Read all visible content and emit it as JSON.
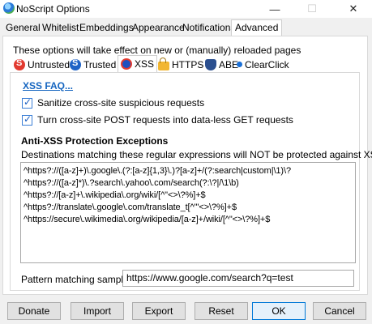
{
  "window": {
    "title": "NoScript Options",
    "minimize": "—",
    "maximize": "☐",
    "close": "✕"
  },
  "main_tabs": [
    {
      "label": "General"
    },
    {
      "label": "Whitelist"
    },
    {
      "label": "Embeddings"
    },
    {
      "label": "Appearance"
    },
    {
      "label": "Notifications"
    },
    {
      "label": "Advanced",
      "active": true
    }
  ],
  "notice": "These options will take effect on new or (manually) reloaded pages",
  "sub_tabs": [
    {
      "label": "Untrusted",
      "icon": "untrusted-icon"
    },
    {
      "label": "Trusted",
      "icon": "trusted-icon"
    },
    {
      "label": "XSS",
      "icon": "xss-icon",
      "active": true
    },
    {
      "label": "HTTPS",
      "icon": "lock-icon"
    },
    {
      "label": "ABE",
      "icon": "abe-icon"
    },
    {
      "label": "ClearClick",
      "icon": "clearclick-icon"
    }
  ],
  "xss": {
    "faq_link": "XSS FAQ...",
    "checkboxes": [
      {
        "label": "Sanitize cross-site suspicious requests",
        "checked": true
      },
      {
        "label": "Turn cross-site POST requests into data-less GET requests",
        "checked": true
      }
    ],
    "section_title": "Anti-XSS Protection Exceptions",
    "section_desc": "Destinations matching these regular expressions will NOT be protected against XSS.",
    "exceptions": [
      "^https?://([a-z]+)\\.google\\.(?:[a-z]{1,3}\\.)?[a-z]+/(?:search|custom|\\1)\\?",
      "^https?://([a-z]*)\\.?search\\.yahoo\\.com/search(?:\\?|/\\1\\b)",
      "^https?://[a-z]+\\.wikipedia\\.org/wiki/[^\"<>\\?%]+$",
      "^https?://translate\\.google\\.com/translate_t[^\"'<>\\?%]+$",
      "^https://secure\\.wikimedia\\.org/wikipedia/[a-z]+/wiki/[^\"<>\\?%]+$"
    ],
    "pattern_label": "Pattern matching sample:",
    "pattern_value": "https://www.google.com/search?q=test"
  },
  "buttons": {
    "donate": "Donate",
    "import": "Import",
    "export": "Export",
    "reset": "Reset",
    "ok": "OK",
    "cancel": "Cancel"
  },
  "colors": {
    "link": "#1565c0",
    "accent": "#0078d7"
  }
}
